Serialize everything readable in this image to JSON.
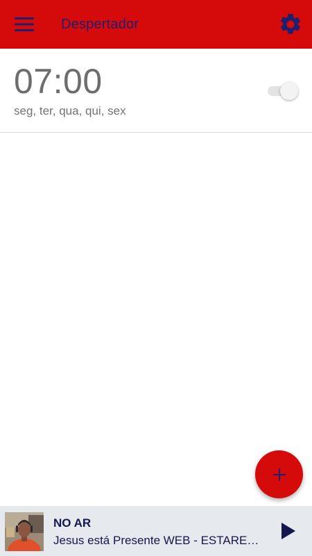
{
  "theme": {
    "primary": "#d50a0b",
    "on_primary": "#1f1f6e",
    "player_bg": "#e6e9ee",
    "player_text": "#16164f"
  },
  "appbar": {
    "title": "Despertador",
    "menu_icon": "hamburger-menu-icon",
    "settings_icon": "gear-icon"
  },
  "alarms": [
    {
      "time": "07:00",
      "days": "seg, ter, qua, qui, sex",
      "enabled": false
    }
  ],
  "fab": {
    "icon": "plus-icon"
  },
  "player": {
    "status": "NO AR",
    "track": "Jesus está Presente WEB - ESTAREMOS",
    "thumbnail_icon": "host-photo",
    "play_icon": "play-icon"
  }
}
